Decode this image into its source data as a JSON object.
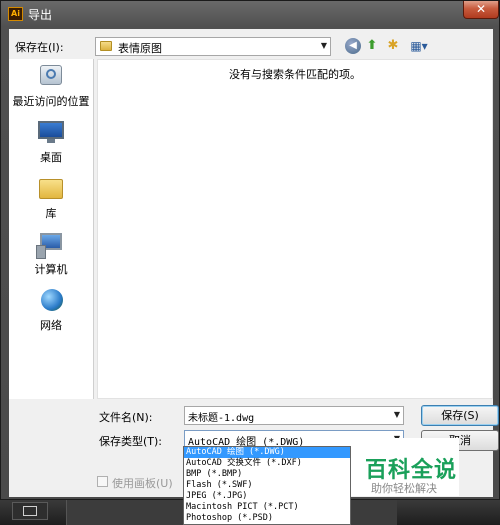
{
  "window": {
    "app_icon": "Ai",
    "title": "导出",
    "close_glyph": "✕"
  },
  "toolbar": {
    "save_in_label": "保存在(I):",
    "location": "表情原图",
    "back_icon": "back-icon",
    "up_icon": "up-folder-icon",
    "new_folder_icon": "new-folder-icon",
    "view_icon": "view-menu-icon"
  },
  "places": [
    {
      "label": "最近访问的位置",
      "icon": "recent-places-icon"
    },
    {
      "label": "桌面",
      "icon": "desktop-icon"
    },
    {
      "label": "库",
      "icon": "library-icon"
    },
    {
      "label": "计算机",
      "icon": "computer-icon"
    },
    {
      "label": "网络",
      "icon": "network-icon"
    }
  ],
  "file_list": {
    "empty_message": "没有与搜索条件匹配的项。"
  },
  "form": {
    "filename_label": "文件名(N):",
    "filename_value": "未标题-1.dwg",
    "filetype_label": "保存类型(T):",
    "filetype_value": "AutoCAD 绘图 (*.DWG)",
    "save_button": "保存(S)",
    "cancel_button": "取消",
    "use_artboards_label": "使用画板(U)"
  },
  "filetype_options": [
    "AutoCAD 绘图 (*.DWG)",
    "AutoCAD 交换文件 (*.DXF)",
    "BMP (*.BMP)",
    "Flash (*.SWF)",
    "JPEG (*.JPG)",
    "Macintosh PICT (*.PCT)",
    "Photoshop (*.PSD)"
  ],
  "selected_filetype_index": 0,
  "watermark": {
    "brand": "百科全说",
    "tagline": "助你轻松解决"
  },
  "colors": {
    "selection": "#3399ff",
    "watermark_green": "#1aa05a",
    "close_button": "#c75b3d"
  }
}
